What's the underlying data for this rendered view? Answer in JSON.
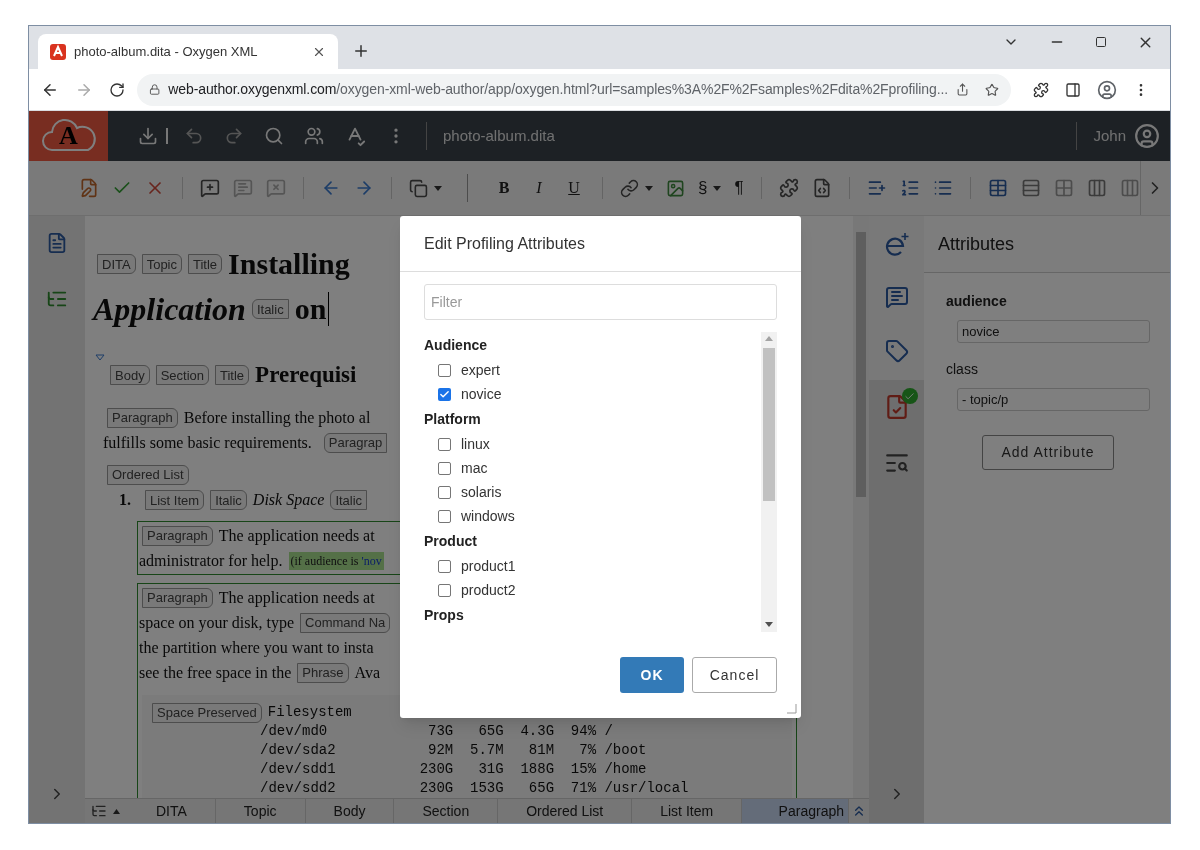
{
  "browser": {
    "tab": {
      "title": "photo-album.dita - Oxygen XML"
    },
    "address": {
      "host": "web-author.oxygenxml.com",
      "path": "/oxygen-xml-web-author/app/oxygen.html?url=samples%3A%2F%2Fsamples%2Fdita%2Fprofiling..."
    }
  },
  "header": {
    "logo_letter": "A",
    "document": "photo-album.dita",
    "user": "John"
  },
  "toolbar": {
    "format_buttons": [
      "B",
      "I",
      "U"
    ],
    "section": "§",
    "pilcrow": "¶"
  },
  "editor": {
    "blocks": [
      {
        "kind": "heading",
        "lines": [
          [
            {
              "kind": "tag",
              "text": "DITA"
            },
            {
              "kind": "tag",
              "text": "Topic"
            },
            {
              "kind": "tag",
              "text": "Title"
            },
            {
              "kind": "title",
              "text": "Installing"
            }
          ],
          [
            {
              "kind": "title_italic",
              "text": "Application"
            },
            {
              "kind": "endtag",
              "text": "Italic"
            },
            {
              "kind": "title",
              "text": "on"
            },
            {
              "kind": "cursor"
            }
          ]
        ]
      },
      {
        "kind": "section",
        "lines": [
          [
            {
              "kind": "tag",
              "text": "Body"
            },
            {
              "kind": "tag",
              "text": "Section"
            },
            {
              "kind": "tag",
              "text": "Title"
            },
            {
              "kind": "subtitle",
              "text": "Prerequisi"
            }
          ]
        ]
      },
      {
        "kind": "body",
        "lines": [
          [
            {
              "kind": "tag",
              "text": "Paragraph"
            },
            {
              "kind": "text",
              "text": "Before installing the photo al"
            }
          ],
          [
            {
              "kind": "text",
              "text": "fulfills some basic requirements."
            },
            {
              "kind": "endtag",
              "text": "Paragrap"
            }
          ],
          [
            {
              "kind": "tag",
              "text": "Ordered List"
            }
          ]
        ]
      },
      {
        "kind": "item",
        "lines": [
          [
            {
              "kind": "number",
              "text": "1."
            },
            {
              "kind": "tag",
              "text": "List Item"
            },
            {
              "kind": "tag",
              "text": "Italic"
            },
            {
              "kind": "italic",
              "text": "Disk Space"
            },
            {
              "kind": "endtag",
              "text": "Italic"
            }
          ]
        ]
      },
      {
        "kind": "tracked",
        "lines": [
          [
            {
              "kind": "tag",
              "text": "Paragraph"
            },
            {
              "kind": "text",
              "text": "The application needs at"
            }
          ],
          [
            {
              "kind": "text",
              "text": "administrator for help."
            },
            {
              "kind": "condition",
              "text": "(if audience is ",
              "value": "'nov"
            }
          ]
        ]
      },
      {
        "kind": "tracked",
        "lines": [
          [
            {
              "kind": "tag",
              "text": "Paragraph"
            },
            {
              "kind": "text",
              "text": "The application needs at"
            }
          ],
          [
            {
              "kind": "text",
              "text": "space on your disk, type"
            },
            {
              "kind": "tag",
              "text": "Command Na"
            }
          ],
          [
            {
              "kind": "text",
              "text": "the partition where you want to insta"
            }
          ],
          [
            {
              "kind": "text",
              "text": "see the free space in the"
            },
            {
              "kind": "tag",
              "text": "Phrase"
            },
            {
              "kind": "text",
              "text": "Ava"
            }
          ]
        ],
        "pre": {
          "tag": "Space Preserved",
          "lines": [
            "Filesystem",
            "/dev/md0            73G   65G  4.3G  94% /",
            "/dev/sda2           92M  5.7M   81M   7% /boot",
            "/dev/sdd1          230G   31G  188G  15% /home",
            "/dev/sdd2          230G  153G   65G  71% /usr/local"
          ]
        }
      }
    ]
  },
  "breadcrumb": [
    {
      "label": "DITA",
      "selected": false
    },
    {
      "label": "Topic",
      "selected": false
    },
    {
      "label": "Body",
      "selected": false
    },
    {
      "label": "Section",
      "selected": false
    },
    {
      "label": "Ordered List",
      "selected": false
    },
    {
      "label": "List Item",
      "selected": false
    },
    {
      "label": "Paragraph",
      "selected": true
    }
  ],
  "attributes_panel": {
    "title": "Attributes",
    "attributes": [
      {
        "name": "audience",
        "value": "novice",
        "bold": true
      },
      {
        "name": "class",
        "value": "- topic/p",
        "bold": false
      }
    ],
    "add_button": "Add Attribute"
  },
  "dialog": {
    "title": "Edit Profiling Attributes",
    "filter": {
      "placeholder": "Filter"
    },
    "groups": [
      {
        "name": "Audience",
        "options": [
          {
            "label": "expert",
            "checked": false
          },
          {
            "label": "novice",
            "checked": true
          }
        ]
      },
      {
        "name": "Platform",
        "options": [
          {
            "label": "linux",
            "checked": false
          },
          {
            "label": "mac",
            "checked": false
          },
          {
            "label": "solaris",
            "checked": false
          },
          {
            "label": "windows",
            "checked": false
          }
        ]
      },
      {
        "name": "Product",
        "options": [
          {
            "label": "product1",
            "checked": false
          },
          {
            "label": "product2",
            "checked": false
          }
        ]
      },
      {
        "name": "Props"
      }
    ],
    "ok": "OK",
    "cancel": "Cancel"
  }
}
